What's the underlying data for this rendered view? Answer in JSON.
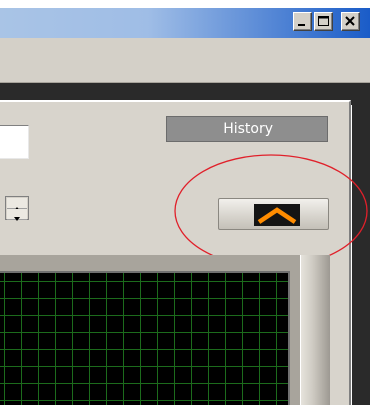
{
  "window": {
    "controls": {
      "minimize_icon": "minimize-icon",
      "restore_icon": "restore-icon",
      "close_icon": "close-icon"
    }
  },
  "panel": {
    "history_label": "History",
    "expand_icon": "chevron-up-icon"
  },
  "colors": {
    "titlebar_start": "#a9c4e6",
    "titlebar_end": "#1a5cc8",
    "panel": "#d8d4cc",
    "history_button": "#8e8e8e",
    "arrow": "#ff8c00",
    "annotation": "#e0202a",
    "grid_line": "#1c6b1c",
    "graph_bg": "#000000"
  }
}
